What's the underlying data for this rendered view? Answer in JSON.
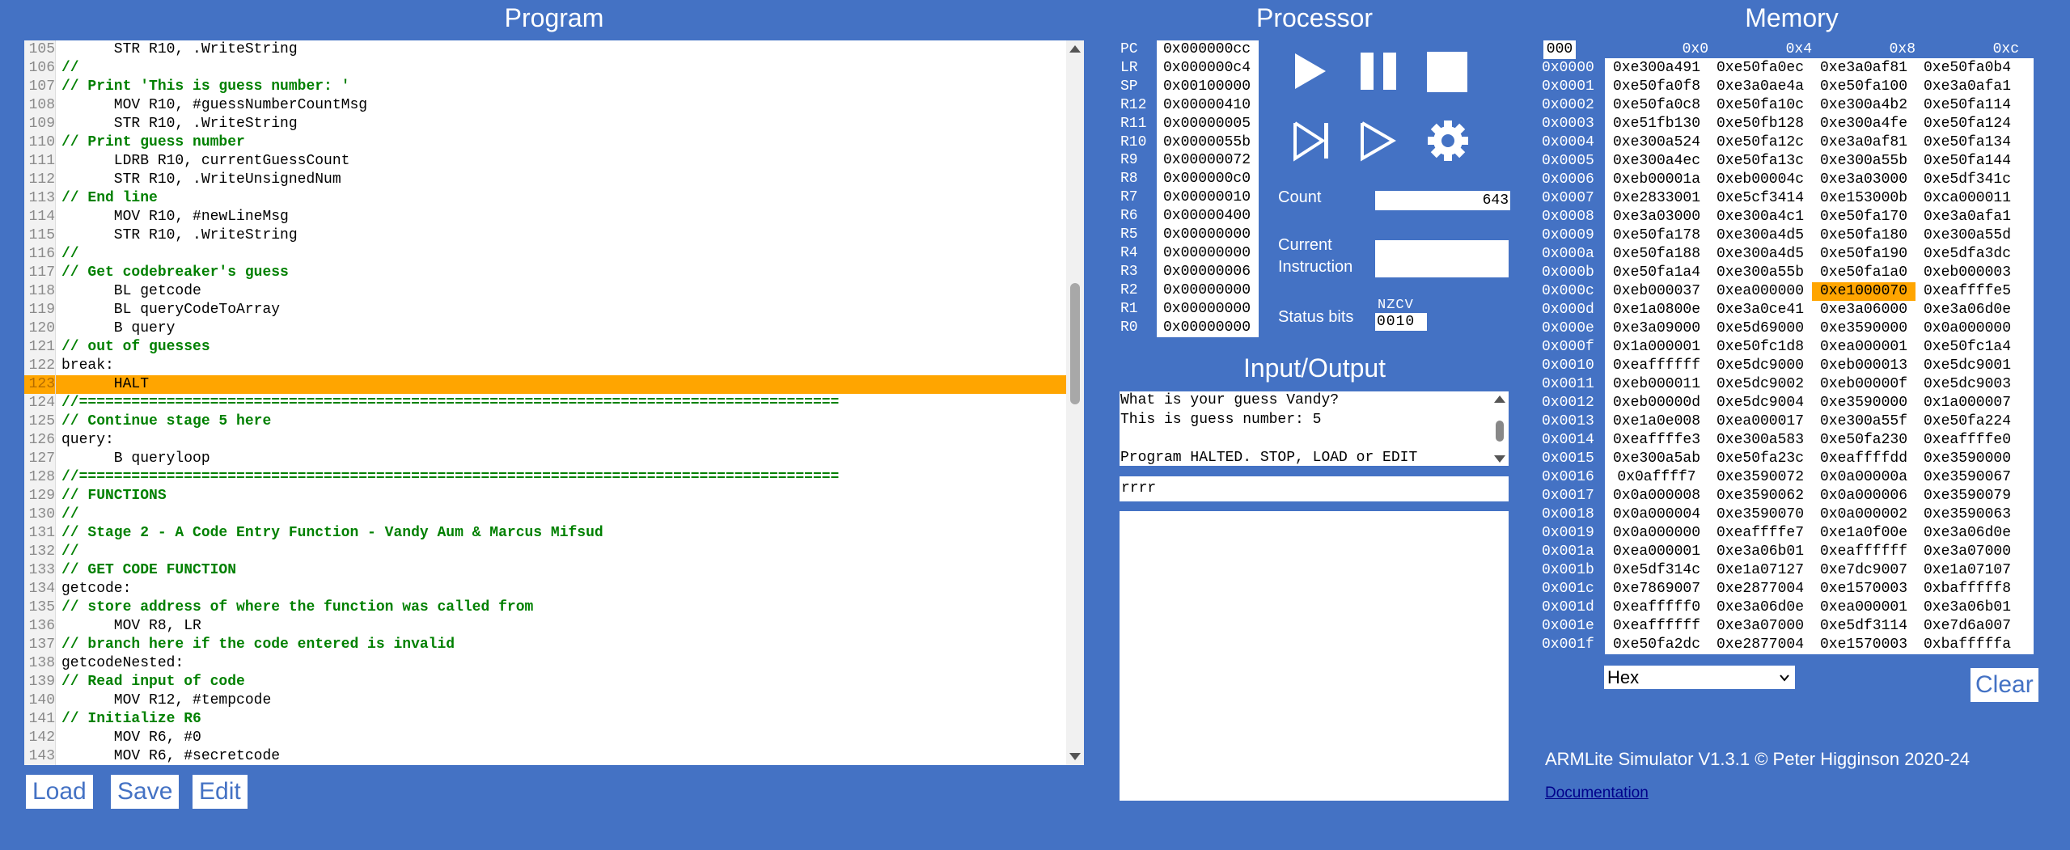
{
  "program": {
    "title": "Program",
    "lines": [
      {
        "n": "105",
        "t": "      STR R10, .WriteString",
        "c": false,
        "hl": false
      },
      {
        "n": "106",
        "t": "//",
        "c": true,
        "hl": false
      },
      {
        "n": "107",
        "t": "// Print 'This is guess number: '",
        "c": true,
        "hl": false
      },
      {
        "n": "108",
        "t": "      MOV R10, #guessNumberCountMsg",
        "c": false,
        "hl": false
      },
      {
        "n": "109",
        "t": "      STR R10, .WriteString",
        "c": false,
        "hl": false
      },
      {
        "n": "110",
        "t": "// Print guess number",
        "c": true,
        "hl": false
      },
      {
        "n": "111",
        "t": "      LDRB R10, currentGuessCount",
        "c": false,
        "hl": false
      },
      {
        "n": "112",
        "t": "      STR R10, .WriteUnsignedNum",
        "c": false,
        "hl": false
      },
      {
        "n": "113",
        "t": "// End line",
        "c": true,
        "hl": false
      },
      {
        "n": "114",
        "t": "      MOV R10, #newLineMsg",
        "c": false,
        "hl": false
      },
      {
        "n": "115",
        "t": "      STR R10, .WriteString",
        "c": false,
        "hl": false
      },
      {
        "n": "116",
        "t": "//",
        "c": true,
        "hl": false
      },
      {
        "n": "117",
        "t": "// Get codebreaker's guess",
        "c": true,
        "hl": false
      },
      {
        "n": "118",
        "t": "      BL getcode",
        "c": false,
        "hl": false
      },
      {
        "n": "119",
        "t": "      BL queryCodeToArray",
        "c": false,
        "hl": false
      },
      {
        "n": "120",
        "t": "      B query",
        "c": false,
        "hl": false
      },
      {
        "n": "121",
        "t": "// out of guesses",
        "c": true,
        "hl": false
      },
      {
        "n": "122",
        "t": "break:",
        "c": false,
        "hl": false
      },
      {
        "n": "123",
        "t": "      HALT",
        "c": false,
        "hl": true
      },
      {
        "n": "124",
        "t": "//=======================================================================================",
        "c": true,
        "hl": false
      },
      {
        "n": "125",
        "t": "// Continue stage 5 here",
        "c": true,
        "hl": false
      },
      {
        "n": "126",
        "t": "query:",
        "c": false,
        "hl": false
      },
      {
        "n": "127",
        "t": "      B queryloop",
        "c": false,
        "hl": false
      },
      {
        "n": "128",
        "t": "//=======================================================================================",
        "c": true,
        "hl": false
      },
      {
        "n": "129",
        "t": "// FUNCTIONS",
        "c": true,
        "hl": false
      },
      {
        "n": "130",
        "t": "//",
        "c": true,
        "hl": false
      },
      {
        "n": "131",
        "t": "// Stage 2 - A Code Entry Function - Vandy Aum & Marcus Mifsud",
        "c": true,
        "hl": false
      },
      {
        "n": "132",
        "t": "//",
        "c": true,
        "hl": false
      },
      {
        "n": "133",
        "t": "// GET CODE FUNCTION",
        "c": true,
        "hl": false
      },
      {
        "n": "134",
        "t": "getcode:",
        "c": false,
        "hl": false
      },
      {
        "n": "135",
        "t": "// store address of where the function was called from",
        "c": true,
        "hl": false
      },
      {
        "n": "136",
        "t": "      MOV R8, LR",
        "c": false,
        "hl": false
      },
      {
        "n": "137",
        "t": "// branch here if the code entered is invalid",
        "c": true,
        "hl": false
      },
      {
        "n": "138",
        "t": "getcodeNested:",
        "c": false,
        "hl": false
      },
      {
        "n": "139",
        "t": "// Read input of code",
        "c": true,
        "hl": false
      },
      {
        "n": "140",
        "t": "      MOV R12, #tempcode",
        "c": false,
        "hl": false
      },
      {
        "n": "141",
        "t": "// Initialize R6",
        "c": true,
        "hl": false
      },
      {
        "n": "142",
        "t": "      MOV R6, #0",
        "c": false,
        "hl": false
      },
      {
        "n": "143",
        "t": "      MOV R6, #secretcode",
        "c": false,
        "hl": false
      }
    ],
    "buttons": {
      "load": "Load",
      "save": "Save",
      "edit": "Edit"
    }
  },
  "processor": {
    "title": "Processor",
    "registers": [
      {
        "name": "PC",
        "value": "0x000000cc"
      },
      {
        "name": "LR",
        "value": "0x000000c4"
      },
      {
        "name": "SP",
        "value": "0x00100000"
      },
      {
        "name": "R12",
        "value": "0x00000410"
      },
      {
        "name": "R11",
        "value": "0x00000005"
      },
      {
        "name": "R10",
        "value": "0x0000055b"
      },
      {
        "name": "R9",
        "value": "0x00000072"
      },
      {
        "name": "R8",
        "value": "0x000000c0"
      },
      {
        "name": "R7",
        "value": "0x00000010"
      },
      {
        "name": "R6",
        "value": "0x00000400"
      },
      {
        "name": "R5",
        "value": "0x00000000"
      },
      {
        "name": "R4",
        "value": "0x00000000"
      },
      {
        "name": "R3",
        "value": "0x00000006"
      },
      {
        "name": "R2",
        "value": "0x00000000"
      },
      {
        "name": "R1",
        "value": "0x00000000"
      },
      {
        "name": "R0",
        "value": "0x00000000"
      }
    ],
    "count_label": "Count",
    "count_value": "643",
    "current_instruction_label1": "Current",
    "current_instruction_label2": "Instruction",
    "current_instruction_value": "",
    "status_bits_label": "Status bits",
    "status_flags": "NZCV",
    "status_value": "0010",
    "icons": [
      "play-icon",
      "pause-icon",
      "stop-icon",
      "step-icon",
      "run-slow-icon",
      "settings-gear-icon"
    ]
  },
  "io": {
    "title": "Input/Output",
    "output": "What is your guess Vandy?\nThis is guess number: 5\n\nProgram HALTED. STOP, LOAD or EDIT",
    "input": "rrrr"
  },
  "memory": {
    "title": "Memory",
    "page": "000",
    "col_headers": [
      "0x0",
      "0x4",
      "0x8",
      "0xc"
    ],
    "rows": [
      {
        "addr": "0x0000",
        "cells": [
          "0xe300a491",
          "0xe50fa0ec",
          "0xe3a0af81",
          "0xe50fa0b4"
        ]
      },
      {
        "addr": "0x0001",
        "cells": [
          "0xe50fa0f8",
          "0xe3a0ae4a",
          "0xe50fa100",
          "0xe3a0afa1"
        ]
      },
      {
        "addr": "0x0002",
        "cells": [
          "0xe50fa0c8",
          "0xe50fa10c",
          "0xe300a4b2",
          "0xe50fa114"
        ]
      },
      {
        "addr": "0x0003",
        "cells": [
          "0xe51fb130",
          "0xe50fb128",
          "0xe300a4fe",
          "0xe50fa124"
        ]
      },
      {
        "addr": "0x0004",
        "cells": [
          "0xe300a524",
          "0xe50fa12c",
          "0xe3a0af81",
          "0xe50fa134"
        ]
      },
      {
        "addr": "0x0005",
        "cells": [
          "0xe300a4ec",
          "0xe50fa13c",
          "0xe300a55b",
          "0xe50fa144"
        ]
      },
      {
        "addr": "0x0006",
        "cells": [
          "0xeb00001a",
          "0xeb00004c",
          "0xe3a03000",
          "0xe5df341c"
        ]
      },
      {
        "addr": "0x0007",
        "cells": [
          "0xe2833001",
          "0xe5cf3414",
          "0xe153000b",
          "0xca000011"
        ]
      },
      {
        "addr": "0x0008",
        "cells": [
          "0xe3a03000",
          "0xe300a4c1",
          "0xe50fa170",
          "0xe3a0afa1"
        ]
      },
      {
        "addr": "0x0009",
        "cells": [
          "0xe50fa178",
          "0xe300a4d5",
          "0xe50fa180",
          "0xe300a55d"
        ]
      },
      {
        "addr": "0x000a",
        "cells": [
          "0xe50fa188",
          "0xe300a4d5",
          "0xe50fa190",
          "0xe5dfa3dc"
        ]
      },
      {
        "addr": "0x000b",
        "cells": [
          "0xe50fa1a4",
          "0xe300a55b",
          "0xe50fa1a0",
          "0xeb000003"
        ]
      },
      {
        "addr": "0x000c",
        "cells": [
          "0xeb000037",
          "0xea000000",
          "0xe1000070",
          "0xeaffffe5"
        ]
      },
      {
        "addr": "0x000d",
        "cells": [
          "0xe1a0800e",
          "0xe3a0ce41",
          "0xe3a06000",
          "0xe3a06d0e"
        ]
      },
      {
        "addr": "0x000e",
        "cells": [
          "0xe3a09000",
          "0xe5d69000",
          "0xe3590000",
          "0x0a000000"
        ]
      },
      {
        "addr": "0x000f",
        "cells": [
          "0x1a000001",
          "0xe50fc1d8",
          "0xea000001",
          "0xe50fc1a4"
        ]
      },
      {
        "addr": "0x0010",
        "cells": [
          "0xeaffffff",
          "0xe5dc9000",
          "0xeb000013",
          "0xe5dc9001"
        ]
      },
      {
        "addr": "0x0011",
        "cells": [
          "0xeb000011",
          "0xe5dc9002",
          "0xeb00000f",
          "0xe5dc9003"
        ]
      },
      {
        "addr": "0x0012",
        "cells": [
          "0xeb00000d",
          "0xe5dc9004",
          "0xe3590000",
          "0x1a000007"
        ]
      },
      {
        "addr": "0x0013",
        "cells": [
          "0xe1a0e008",
          "0xea000017",
          "0xe300a55f",
          "0xe50fa224"
        ]
      },
      {
        "addr": "0x0014",
        "cells": [
          "0xeaffffe3",
          "0xe300a583",
          "0xe50fa230",
          "0xeaffffe0"
        ]
      },
      {
        "addr": "0x0015",
        "cells": [
          "0xe300a5ab",
          "0xe50fa23c",
          "0xeaffffdd",
          "0xe3590000"
        ]
      },
      {
        "addr": "0x0016",
        "cells": [
          "0x0affff7",
          "0xe3590072",
          "0x0a00000a",
          "0xe3590067"
        ]
      },
      {
        "addr": "0x0017",
        "cells": [
          "0x0a000008",
          "0xe3590062",
          "0x0a000006",
          "0xe3590079"
        ]
      },
      {
        "addr": "0x0018",
        "cells": [
          "0x0a000004",
          "0xe3590070",
          "0x0a000002",
          "0xe3590063"
        ]
      },
      {
        "addr": "0x0019",
        "cells": [
          "0x0a000000",
          "0xeaffffe7",
          "0xe1a0f00e",
          "0xe3a06d0e"
        ]
      },
      {
        "addr": "0x001a",
        "cells": [
          "0xea000001",
          "0xe3a06b01",
          "0xeaffffff",
          "0xe3a07000"
        ]
      },
      {
        "addr": "0x001b",
        "cells": [
          "0xe5df314c",
          "0xe1a07127",
          "0xe7dc9007",
          "0xe1a07107"
        ]
      },
      {
        "addr": "0x001c",
        "cells": [
          "0xe7869007",
          "0xe2877004",
          "0xe1570003",
          "0xbafffff8"
        ]
      },
      {
        "addr": "0x001d",
        "cells": [
          "0xeafffff0",
          "0xe3a06d0e",
          "0xea000001",
          "0xe3a06b01"
        ]
      },
      {
        "addr": "0x001e",
        "cells": [
          "0xeaffffff",
          "0xe3a07000",
          "0xe5df3114",
          "0xe7d6a007"
        ]
      },
      {
        "addr": "0x001f",
        "cells": [
          "0xe50fa2dc",
          "0xe2877004",
          "0xe1570003",
          "0xbafffffa"
        ]
      }
    ],
    "highlight": {
      "row": 12,
      "col": 2
    },
    "format": "Hex",
    "clear_label": "Clear"
  },
  "footer": {
    "copyright": "ARMLite Simulator V1.3.1 © Peter Higginson 2020-24",
    "doc_link": "Documentation"
  },
  "colors": {
    "background": "#4472c4",
    "highlight": "#ffa500",
    "comment": "#008000"
  }
}
